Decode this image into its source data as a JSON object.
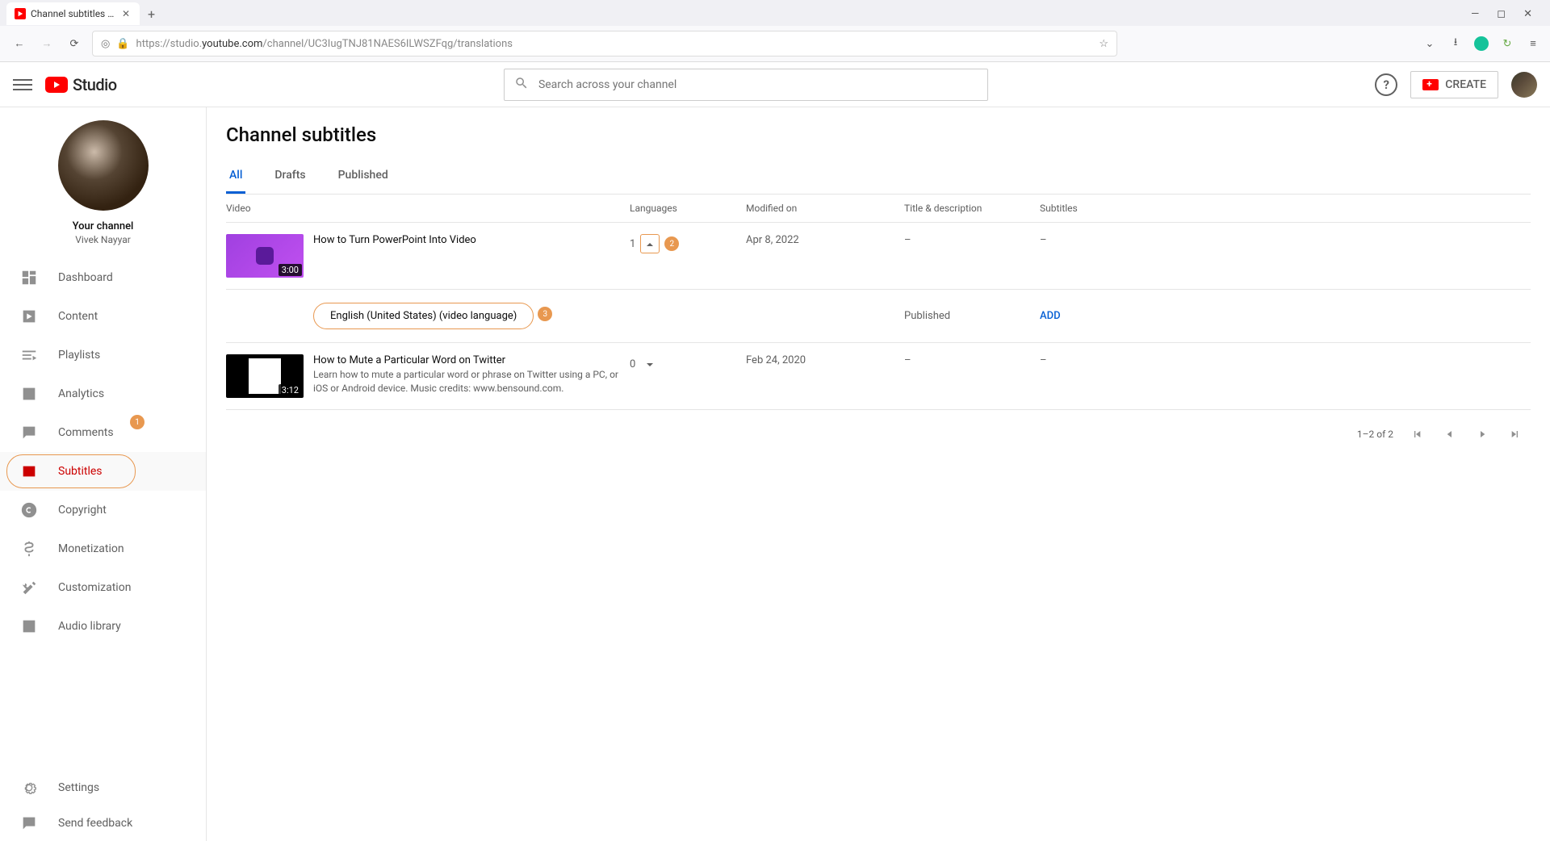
{
  "browser": {
    "tab_title": "Channel subtitles - YouTube St",
    "url_prefix": "https://studio.",
    "url_host": "youtube.com",
    "url_path": "/channel/UC3IugTNJ81NAES6ILWSZFqg/translations"
  },
  "header": {
    "logo_text": "Studio",
    "search_placeholder": "Search across your channel",
    "create_label": "CREATE"
  },
  "sidebar": {
    "channel_label": "Your channel",
    "channel_name": "Vivek Nayyar",
    "items": [
      {
        "label": "Dashboard"
      },
      {
        "label": "Content"
      },
      {
        "label": "Playlists"
      },
      {
        "label": "Analytics"
      },
      {
        "label": "Comments"
      },
      {
        "label": "Subtitles"
      },
      {
        "label": "Copyright"
      },
      {
        "label": "Monetization"
      },
      {
        "label": "Customization"
      },
      {
        "label": "Audio library"
      }
    ],
    "footer": [
      {
        "label": "Settings"
      },
      {
        "label": "Send feedback"
      }
    ]
  },
  "main": {
    "title": "Channel subtitles",
    "tabs": [
      {
        "label": "All",
        "active": true
      },
      {
        "label": "Drafts"
      },
      {
        "label": "Published"
      }
    ],
    "columns": {
      "video": "Video",
      "languages": "Languages",
      "modified": "Modified on",
      "titledesc": "Title & description",
      "subtitles": "Subtitles"
    },
    "rows": [
      {
        "title": "How to Turn PowerPoint Into Video",
        "duration": "3:00",
        "lang_count": "1",
        "modified": "Apr 8, 2022",
        "titledesc": "–",
        "subtitles": "–",
        "sub": {
          "language": "English (United States) (video language)",
          "titledesc": "Published",
          "add": "ADD"
        }
      },
      {
        "title": "How to Mute a Particular Word on Twitter",
        "desc": "Learn how to mute a particular word or phrase on Twitter using a PC, or iOS or Android device. Music credits: www.bensound.com.",
        "duration": "3:12",
        "lang_count": "0",
        "modified": "Feb 24, 2020",
        "titledesc": "–",
        "subtitles": "–"
      }
    ],
    "pager": "1–2 of 2"
  },
  "callouts": {
    "sidebar": "1",
    "chevron": "2",
    "language": "3"
  }
}
